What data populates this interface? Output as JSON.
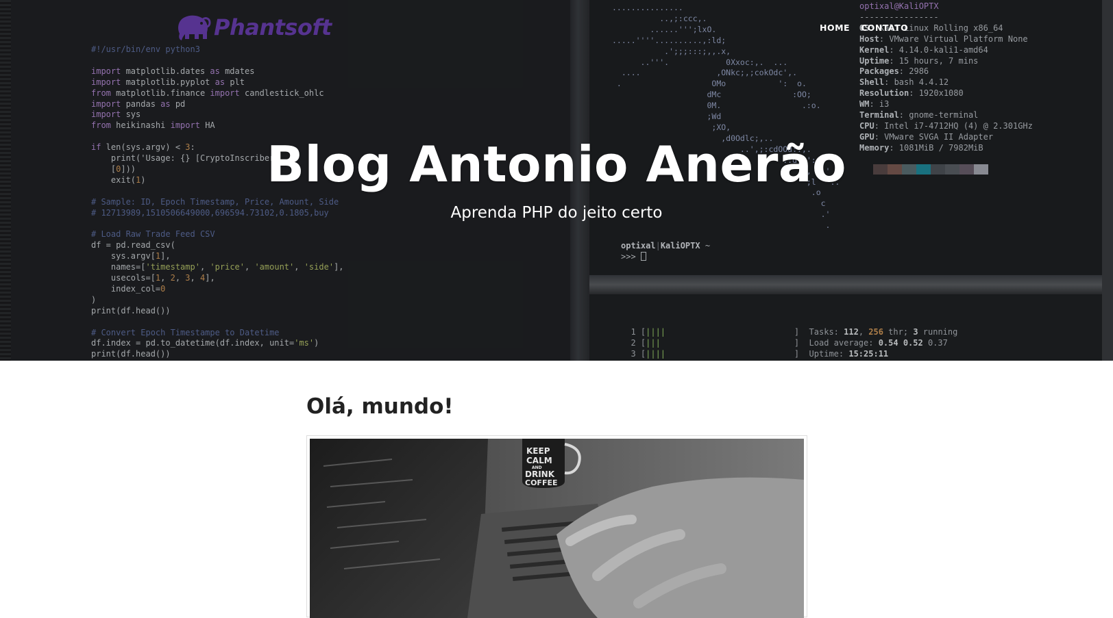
{
  "nav": {
    "items": [
      {
        "label": "HOME"
      },
      {
        "label": "CONTATO"
      }
    ]
  },
  "hero": {
    "title": "Blog Antonio Anerão",
    "subtitle": "Aprenda PHP do jeito certo",
    "logo_text": "Phantsoft",
    "code_lines": [
      "#!/usr/bin/env python3",
      "",
      "import matplotlib.dates as mdates",
      "import matplotlib.pyplot as plt",
      "from matplotlib.finance import candlestick_ohlc",
      "import pandas as pd",
      "import sys",
      "from heikinashi import HA",
      "",
      "if len(sys.argv) < 3:",
      "    print('Usage: {} [CryptoInscriber",
      "    [0]))",
      "    exit(1)",
      "",
      "# Sample: ID, Epoch Timestamp, Price, Amount, Side",
      "# 12713989,1510506649000,696594.73102,0.1805,buy",
      "",
      "# Load Raw Trade Feed CSV",
      "df = pd.read_csv(",
      "    sys.argv[1],",
      "    names=['timestamp', 'price', 'amount', 'side'],",
      "    usecols=[1, 2, 3, 4],",
      "    index_col=0",
      ")",
      "print(df.head())",
      "",
      "# Convert Epoch Timestampe to Datetime",
      "df.index = pd.to_datetime(df.index, unit='ms')",
      "print(df.head())"
    ],
    "sysinfo": {
      "user": "optixal@KaliOPTX",
      "separator": "----------------",
      "rows": [
        {
          "k": "OS",
          "v": "Kali Linux Rolling x86_64"
        },
        {
          "k": "Host",
          "v": "VMware Virtual Platform None"
        },
        {
          "k": "Kernel",
          "v": "4.14.0-kali1-amd64"
        },
        {
          "k": "Uptime",
          "v": "15 hours, 7 mins"
        },
        {
          "k": "Packages",
          "v": "2986"
        },
        {
          "k": "Shell",
          "v": "bash 4.4.12"
        },
        {
          "k": "Resolution",
          "v": "1920x1080"
        },
        {
          "k": "WM",
          "v": "i3"
        },
        {
          "k": "Terminal",
          "v": "gnome-terminal"
        },
        {
          "k": "CPU",
          "v": "Intel i7-4712HQ (4) @ 2.301GHz"
        },
        {
          "k": "GPU",
          "v": "VMware SVGA II Adapter"
        },
        {
          "k": "Memory",
          "v": "1081MiB / 7982MiB"
        }
      ],
      "palette": [
        "#5a4a4a",
        "#7a5a52",
        "#5b6f74",
        "#1f8a9c",
        "#4e5258",
        "#5a5e64",
        "#6a5f6c",
        "#a7a9b2"
      ]
    },
    "prompt": {
      "user": "optixal",
      "host": "KaliOPTX",
      "path": "~",
      "symbol": ">>>"
    },
    "htop": {
      "rows": [
        "1",
        "2",
        "3"
      ],
      "tasks_label": "Tasks:",
      "tasks": "112",
      "thr": "256",
      "thr_label": "thr;",
      "running": "3",
      "running_label": "running",
      "load_label": "Load average:",
      "load": [
        "0.54",
        "0.52",
        "0.37"
      ],
      "uptime_label": "Uptime:",
      "uptime": "15:25:11"
    }
  },
  "post": {
    "title": "Olá, mundo!"
  }
}
